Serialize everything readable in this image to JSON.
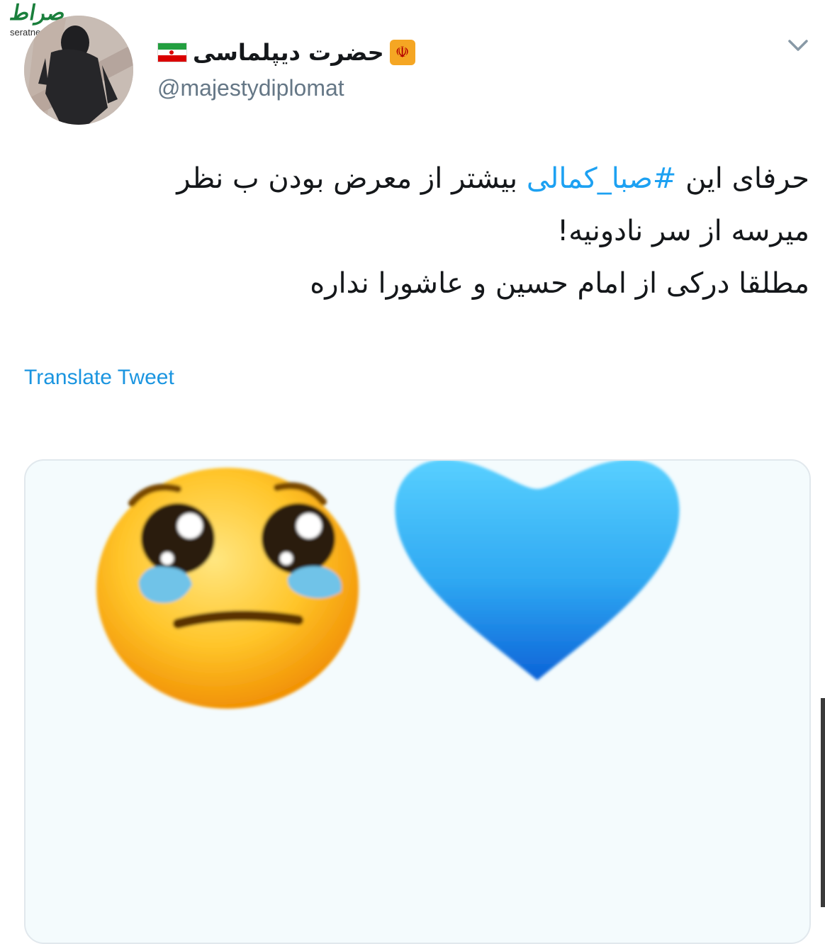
{
  "watermark": {
    "logo": "صراط",
    "site": "seratnews.ir"
  },
  "tweet": {
    "display_name": "حضرت دیپلماسی",
    "handle": "@majestydiplomat",
    "text_lines": [
      {
        "before": "حرفای این ",
        "hashtag": "#صبا_کمالی",
        "after": " بیشتر از معرض بودن ب نظر"
      },
      {
        "text": "میرسه از سر نادونیه!"
      },
      {
        "text": "مطلقا درکی از امام حسین و عاشورا نداره"
      }
    ],
    "translate_label": "Translate Tweet",
    "media": {
      "emoji": [
        "pleading-face-crying",
        "blue-heart"
      ]
    }
  },
  "icons": {
    "flag": "iran-flag-icon",
    "emblem": "iran-emblem-icon",
    "menu": "chevron-down-icon"
  },
  "colors": {
    "link": "#1da1f2",
    "handle": "#657786",
    "text": "#14171a"
  }
}
